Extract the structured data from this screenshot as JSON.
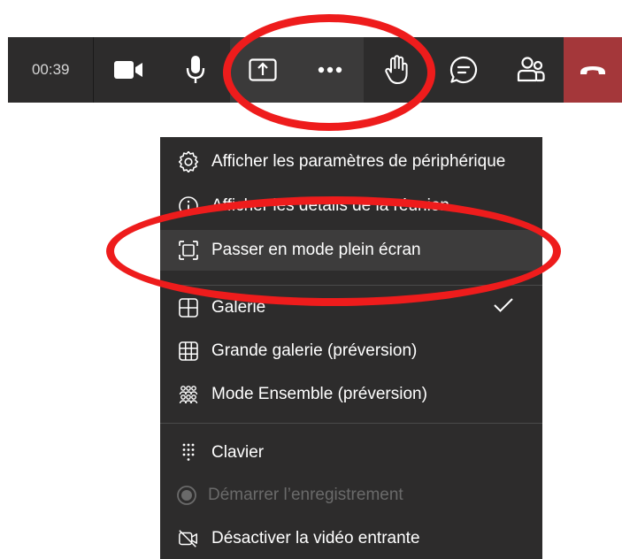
{
  "toolbar": {
    "timer": "00:39"
  },
  "menu": {
    "items": [
      {
        "label": "Afficher les paramètres de périphérique"
      },
      {
        "label": "Afficher les détails de la réunion"
      },
      {
        "label": "Passer en mode plein écran"
      },
      {
        "label": "Galerie"
      },
      {
        "label": "Grande galerie (préversion)"
      },
      {
        "label": "Mode Ensemble (préversion)"
      },
      {
        "label": "Clavier"
      },
      {
        "label": "Démarrer l’enregistrement"
      },
      {
        "label": "Désactiver la vidéo entrante"
      }
    ]
  },
  "colors": {
    "toolbar_bg": "#2d2c2c",
    "hangup": "#a4373a",
    "annotation": "#ee1c1c"
  }
}
